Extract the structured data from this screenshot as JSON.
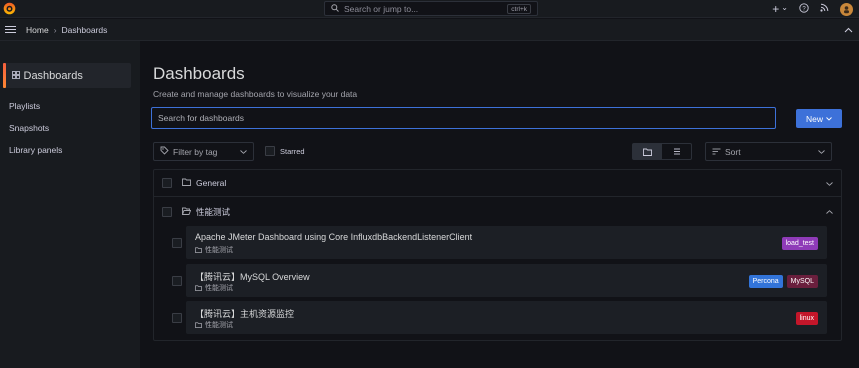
{
  "topbar": {
    "search_placeholder": "Search or jump to...",
    "shortcut": "ctrl+k",
    "add_label": "+",
    "add_chevron": "⌄",
    "help_icon": "help-circle-icon",
    "news_icon": "rss-icon"
  },
  "breadcrumb": {
    "home": "Home",
    "separator": "›",
    "current": "Dashboards"
  },
  "sidebar": {
    "active": "Dashboards",
    "items": [
      "Playlists",
      "Snapshots",
      "Library panels"
    ]
  },
  "page": {
    "title": "Dashboards",
    "subtitle": "Create and manage dashboards to visualize your data",
    "search_placeholder": "Search for dashboards",
    "new_label": "New",
    "filter_label": "Filter by tag",
    "starred_label": "Starred",
    "sort_label": "Sort"
  },
  "folders": [
    {
      "name": "General",
      "expanded": false
    },
    {
      "name": "性能测试",
      "expanded": true
    }
  ],
  "dashboards": [
    {
      "title": "Apache JMeter Dashboard using Core InfluxdbBackendListenerClient",
      "folder": "性能测试",
      "tags": [
        {
          "label": "load_test",
          "color": "#8f3bb8"
        }
      ]
    },
    {
      "title": "【腾讯云】MySQL Overview",
      "folder": "性能测试",
      "tags": [
        {
          "label": "Percona",
          "color": "#3274d9"
        },
        {
          "label": "MySQL",
          "color": "#6a1f3d"
        }
      ]
    },
    {
      "title": "【腾讯云】主机资源监控",
      "folder": "性能测试",
      "tags": [
        {
          "label": "linux",
          "color": "#c4162a"
        }
      ]
    }
  ],
  "colors": {
    "accent": "#3d71d9",
    "background": "#111217",
    "panel": "#181b1f"
  }
}
